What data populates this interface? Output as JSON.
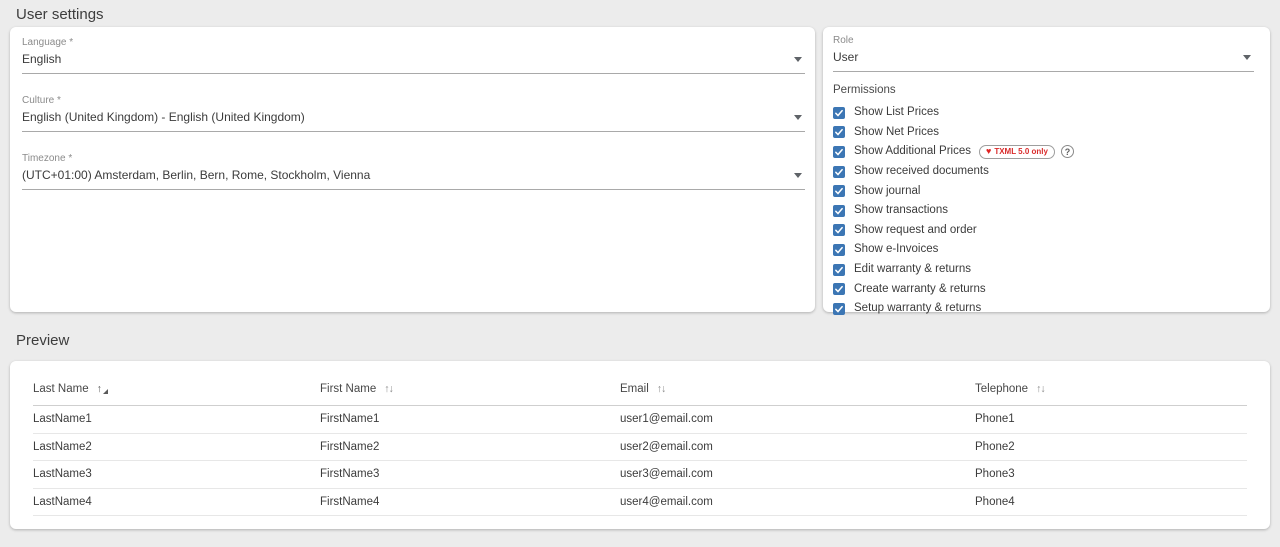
{
  "page": {
    "title": "User settings"
  },
  "left_card": {
    "fields": [
      {
        "name": "language",
        "label": "Language *",
        "value": "English"
      },
      {
        "name": "culture",
        "label": "Culture *",
        "value": "English (United Kingdom) - English (United Kingdom)"
      },
      {
        "name": "timezone",
        "label": "Timezone *",
        "value": "(UTC+01:00) Amsterdam, Berlin, Bern, Rome, Stockholm, Vienna"
      }
    ]
  },
  "right_card": {
    "role": {
      "label": "Role",
      "value": "User"
    },
    "permissions": {
      "heading": "Permissions",
      "items": [
        {
          "label": "Show List Prices",
          "checked": true
        },
        {
          "label": "Show Net Prices",
          "checked": true
        },
        {
          "label": "Show Additional Prices",
          "checked": true,
          "badge": {
            "icon": "heart-icon",
            "text": "TXML 5.0 only"
          },
          "help": "?"
        },
        {
          "label": "Show received documents",
          "checked": true
        },
        {
          "label": "Show journal",
          "checked": true
        },
        {
          "label": "Show transactions",
          "checked": true
        },
        {
          "label": "Show request and order",
          "checked": true
        },
        {
          "label": "Show e-Invoices",
          "checked": true
        },
        {
          "label": "Edit warranty & returns",
          "checked": true
        },
        {
          "label": "Create warranty & returns",
          "checked": true
        },
        {
          "label": "Setup warranty & returns",
          "checked": true
        }
      ]
    }
  },
  "preview": {
    "title": "Preview",
    "table": {
      "columns": [
        {
          "label": "Last Name",
          "sort": "asc"
        },
        {
          "label": "First Name",
          "sort": "none"
        },
        {
          "label": "Email",
          "sort": "none"
        },
        {
          "label": "Telephone",
          "sort": "none"
        }
      ],
      "rows": [
        [
          "LastName1",
          "FirstName1",
          "user1@email.com",
          "Phone1"
        ],
        [
          "LastName2",
          "FirstName2",
          "user2@email.com",
          "Phone2"
        ],
        [
          "LastName3",
          "FirstName3",
          "user3@email.com",
          "Phone3"
        ],
        [
          "LastName4",
          "FirstName4",
          "user4@email.com",
          "Phone4"
        ]
      ]
    }
  },
  "colors": {
    "checkbox_blue": "#3c76b4",
    "badge_red": "#d92b2b",
    "heart_red": "#e02424",
    "background": "#ececec",
    "card": "#ffffff"
  },
  "icons": {
    "dropdown": "chevron-down-icon",
    "sort_active": "sort-ascending-icon",
    "sort_inactive": "sort-both-icon",
    "badge_heart": "heart-icon",
    "help": "help-circle-icon",
    "checkbox_check": "checkmark-icon"
  }
}
